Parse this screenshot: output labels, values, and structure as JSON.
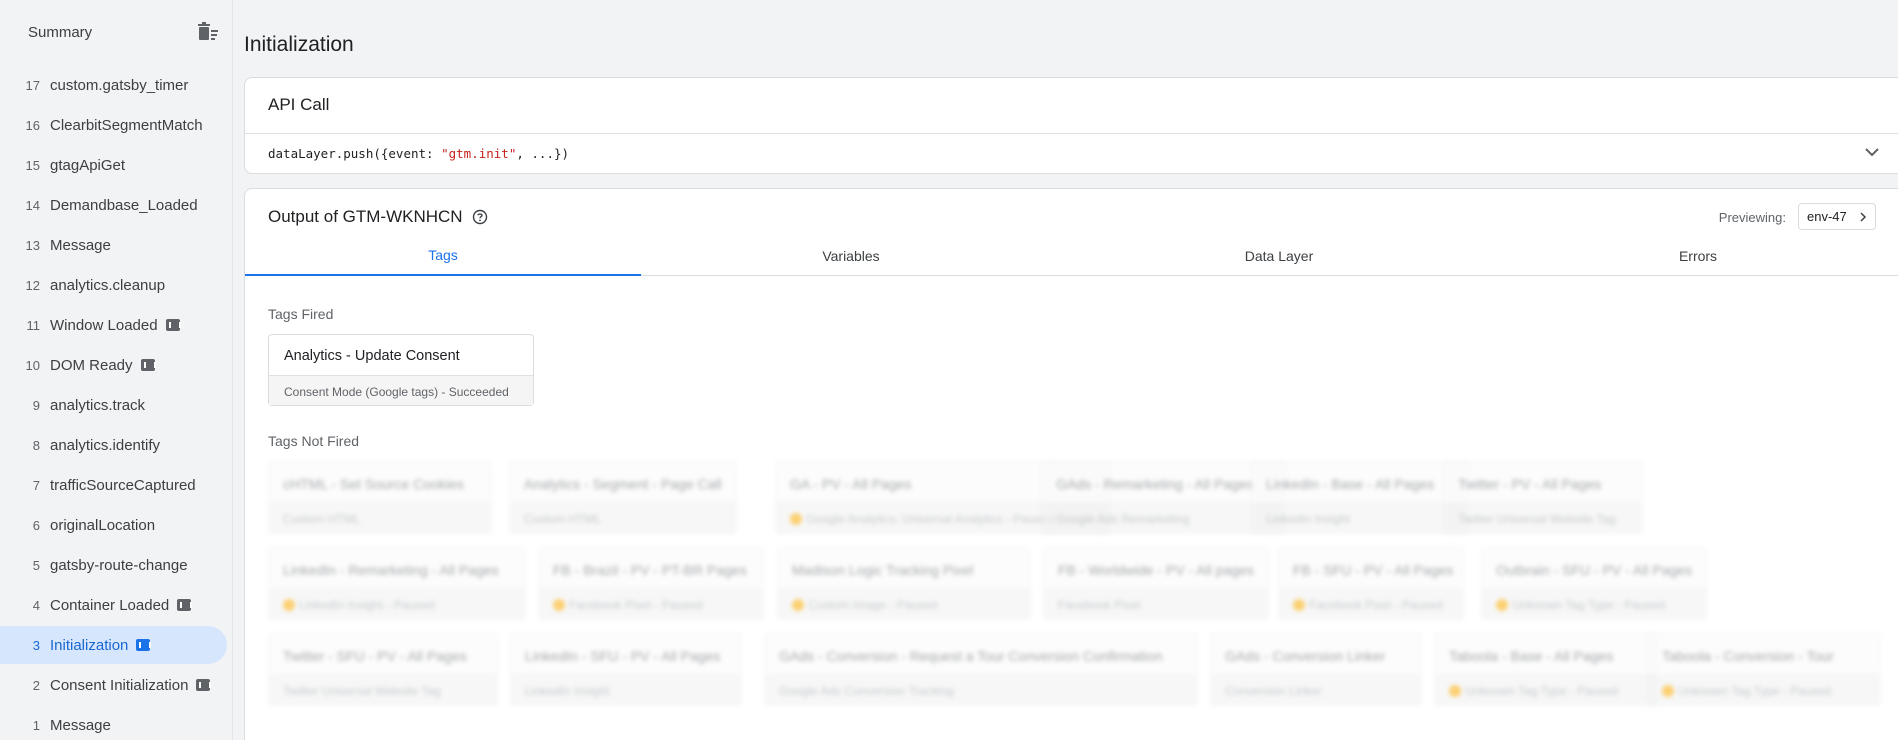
{
  "sidebar": {
    "header": "Summary",
    "events": [
      {
        "num": "17",
        "label": "custom.gatsby_timer",
        "badge": false
      },
      {
        "num": "16",
        "label": "ClearbitSegmentMatch",
        "badge": false
      },
      {
        "num": "15",
        "label": "gtagApiGet",
        "badge": false
      },
      {
        "num": "14",
        "label": "Demandbase_Loaded",
        "badge": false
      },
      {
        "num": "13",
        "label": "Message",
        "badge": false
      },
      {
        "num": "12",
        "label": "analytics.cleanup",
        "badge": false
      },
      {
        "num": "11",
        "label": "Window Loaded",
        "badge": true
      },
      {
        "num": "10",
        "label": "DOM Ready",
        "badge": true
      },
      {
        "num": "9",
        "label": "analytics.track",
        "badge": false
      },
      {
        "num": "8",
        "label": "analytics.identify",
        "badge": false
      },
      {
        "num": "7",
        "label": "trafficSourceCaptured",
        "badge": false
      },
      {
        "num": "6",
        "label": "originalLocation",
        "badge": false
      },
      {
        "num": "5",
        "label": "gatsby-route-change",
        "badge": false
      },
      {
        "num": "4",
        "label": "Container Loaded",
        "badge": true
      },
      {
        "num": "3",
        "label": "Initialization",
        "badge": true,
        "selected": true
      },
      {
        "num": "2",
        "label": "Consent Initialization",
        "badge": true
      },
      {
        "num": "1",
        "label": "Message",
        "badge": false
      }
    ]
  },
  "main": {
    "title": "Initialization",
    "api_call": {
      "title": "API Call",
      "code_prefix": "dataLayer.push({event: ",
      "code_string": "\"gtm.init\"",
      "code_suffix": ", ...})"
    },
    "output": {
      "title": "Output of GTM-WKNHCN",
      "previewing_label": "Previewing:",
      "env": "env-47",
      "tabs": [
        "Tags",
        "Variables",
        "Data Layer",
        "Errors"
      ],
      "active_tab": "Tags",
      "tags_fired_label": "Tags Fired",
      "tags_fired": [
        {
          "name": "Analytics - Update Consent",
          "status": "Consent Mode (Google tags) - Succeeded"
        }
      ],
      "tags_not_fired_label": "Tags Not Fired",
      "tags_not_fired": [
        {
          "name": "cHTML - Set Source Cookies",
          "status": "Custom HTML",
          "paused": false
        },
        {
          "name": "Analytics - Segment - Page Call",
          "status": "Custom HTML",
          "paused": false
        },
        {
          "name": "GA - PV - All Pages",
          "status": "Google Analytics: Universal Analytics - Paused",
          "paused": true
        },
        {
          "name": "GAds - Remarketing - All Pages",
          "status": "Google Ads Remarketing",
          "paused": false
        },
        {
          "name": "LinkedIn - Base - All Pages",
          "status": "LinkedIn Insight",
          "paused": false
        },
        {
          "name": "Twitter - PV - All Pages",
          "status": "Twitter Universal Website Tag",
          "paused": false
        },
        {
          "name": "LinkedIn - Remarketing - All Pages",
          "status": "LinkedIn Insight - Paused",
          "paused": true
        },
        {
          "name": "FB - Brazil - PV - PT-BR Pages",
          "status": "Facebook Pixel - Paused",
          "paused": true
        },
        {
          "name": "Madison Logic Tracking Pixel",
          "status": "Custom Image - Paused",
          "paused": true
        },
        {
          "name": "FB - Worldwide - PV - All pages",
          "status": "Facebook Pixel",
          "paused": false
        },
        {
          "name": "FB - SFU - PV - All Pages",
          "status": "Facebook Pixel - Paused",
          "paused": true
        },
        {
          "name": "Outbrain - SFU - PV - All Pages",
          "status": "Unknown Tag Type - Paused",
          "paused": true
        },
        {
          "name": "Twitter - SFU - PV - All Pages",
          "status": "Twitter Universal Website Tag",
          "paused": false
        },
        {
          "name": "LinkedIn - SFU - PV - All Pages",
          "status": "LinkedIn Insight",
          "paused": false
        },
        {
          "name": "GAds - Conversion - Request a Tour Conversion Confirmation",
          "status": "Google Ads Conversion Tracking",
          "paused": false
        },
        {
          "name": "GAds - Conversion Linker",
          "status": "Conversion Linker",
          "paused": false
        },
        {
          "name": "Taboola - Base - All Pages",
          "status": "Unknown Tag Type - Paused",
          "paused": true
        },
        {
          "name": "Taboola - Conversion - Tour",
          "status": "Unknown Tag Type - Paused",
          "paused": true
        }
      ]
    }
  }
}
